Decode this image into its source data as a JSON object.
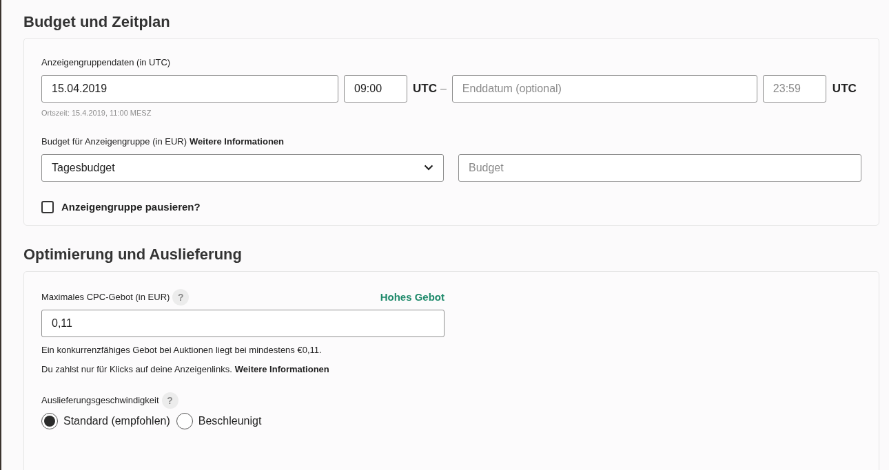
{
  "sections": [
    {
      "title": "Budget und Zeitplan"
    },
    {
      "title": "Optimierung und Auslieferung"
    }
  ],
  "schedule": {
    "label": "Anzeigengruppendaten (in UTC)",
    "start_date": {
      "value": "15.04.2019"
    },
    "start_time": {
      "value": "09:00"
    },
    "start_tz": "UTC",
    "separator": "–",
    "end_date": {
      "placeholder": "Enddatum (optional)"
    },
    "end_time": {
      "placeholder": "23:59"
    },
    "end_tz": "UTC",
    "local_time": "Ortszeit: 15.4.2019, 11:00 MESZ"
  },
  "budget": {
    "label": "Budget für Anzeigengruppe (in EUR)",
    "link": "Weitere Informationen",
    "type": {
      "value": "Tagesbudget"
    },
    "amount": {
      "placeholder": "Budget"
    }
  },
  "pause": {
    "label": "Anzeigengruppe pausieren?",
    "checked": false
  },
  "bid": {
    "label": "Maximales CPC-Gebot (in EUR)",
    "help": "?",
    "status": "Hohes Gebot",
    "value": "0,11",
    "note": "Ein konkurrenzfähiges Gebot bei Auktionen liegt bei mindestens €0,11.",
    "note2": "Du zahlst nur für Klicks auf deine Anzeigenlinks.",
    "link": "Weitere Informationen"
  },
  "delivery": {
    "label": "Auslieferungsgeschwindigkeit",
    "help": "?",
    "options": [
      {
        "label": "Standard (empfohlen)",
        "selected": true
      },
      {
        "label": "Beschleunigt",
        "selected": false
      }
    ]
  }
}
